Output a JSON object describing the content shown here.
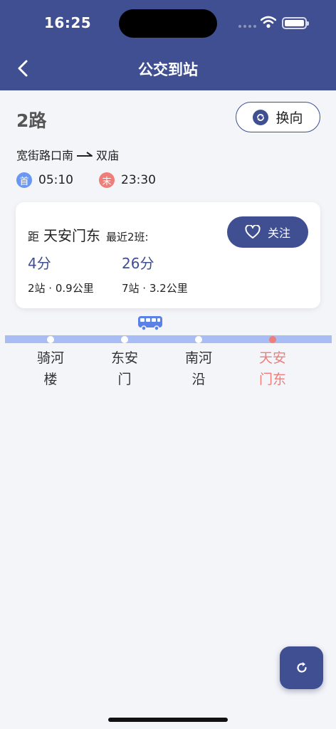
{
  "status_bar": {
    "time": "16:25"
  },
  "nav": {
    "title": "公交到站"
  },
  "route": {
    "name": "2路",
    "from": "宽街路口南",
    "to": "双庙",
    "first_label": "首",
    "first_time": "05:10",
    "last_label": "末",
    "last_time": "23:30"
  },
  "switch_button": {
    "label": "换向"
  },
  "card": {
    "prefix": "距",
    "stop": "天安门东",
    "recent": "最近2班:",
    "follow_label": "关注",
    "arrivals": [
      {
        "minutes": "4分",
        "info": "2站 · 0.9公里"
      },
      {
        "minutes": "26分",
        "info": "7站 · 3.2公里"
      }
    ]
  },
  "stops": [
    {
      "name": "骑河楼"
    },
    {
      "name": "东安门"
    },
    {
      "name": "南河沿"
    },
    {
      "name": "天安门东"
    }
  ],
  "colors": {
    "primary": "#3f4f92",
    "track": "#a8bdf3",
    "current": "#ef7d7a",
    "first_badge": "#6a97f2"
  }
}
